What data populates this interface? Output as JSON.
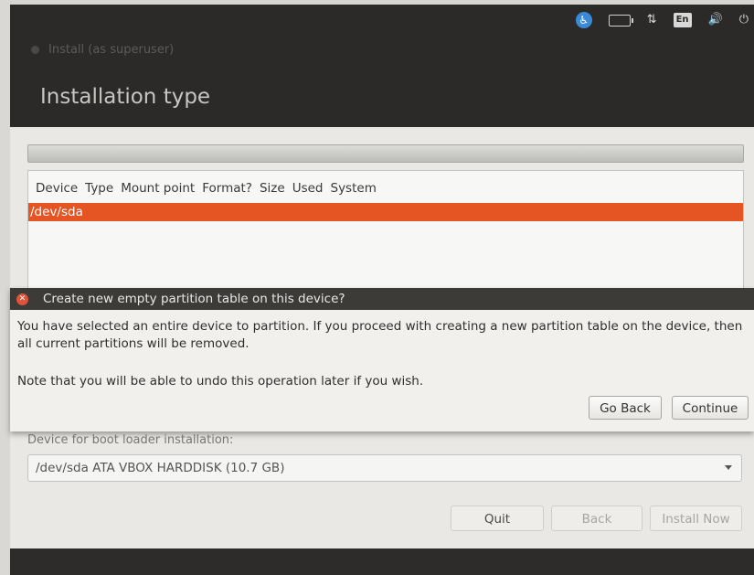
{
  "system_panel": {
    "indicators": [
      {
        "icon": "accessibility-icon",
        "glyph": "♿"
      },
      {
        "icon": "battery-icon",
        "glyph": ""
      },
      {
        "icon": "network-icon",
        "glyph": "⇅"
      },
      {
        "icon": "keyboard-layout-icon",
        "glyph": "En"
      },
      {
        "icon": "volume-icon",
        "glyph": "🔊"
      },
      {
        "icon": "power-icon",
        "glyph": "⏻"
      }
    ]
  },
  "window": {
    "title": "Install (as superuser)",
    "page_title": "Installation type"
  },
  "table": {
    "headers": [
      "Device",
      "Type",
      "Mount point",
      "Format?",
      "Size",
      "Used",
      "System"
    ],
    "rows": [
      {
        "device": "/dev/sda",
        "selected": true
      }
    ]
  },
  "dialog": {
    "title": "Create new empty partition table on this device?",
    "message": "You have selected an entire device to partition. If you proceed with creating a new partition table on the device, then all current partitions will be removed.",
    "note": "Note that you will be able to undo this operation later if you wish.",
    "go_back_label": "Go Back",
    "continue_label": "Continue"
  },
  "boot_loader": {
    "label": "Device for boot loader installation:",
    "selected_value": "/dev/sda ATA VBOX HARDDISK (10.7 GB)"
  },
  "buttons": {
    "quit_label": "Quit",
    "back_label": "Back",
    "install_now_label": "Install Now"
  },
  "colors": {
    "selection": "#e55524",
    "panel": "#2b2a28",
    "dialog_close": "#e0533a"
  }
}
